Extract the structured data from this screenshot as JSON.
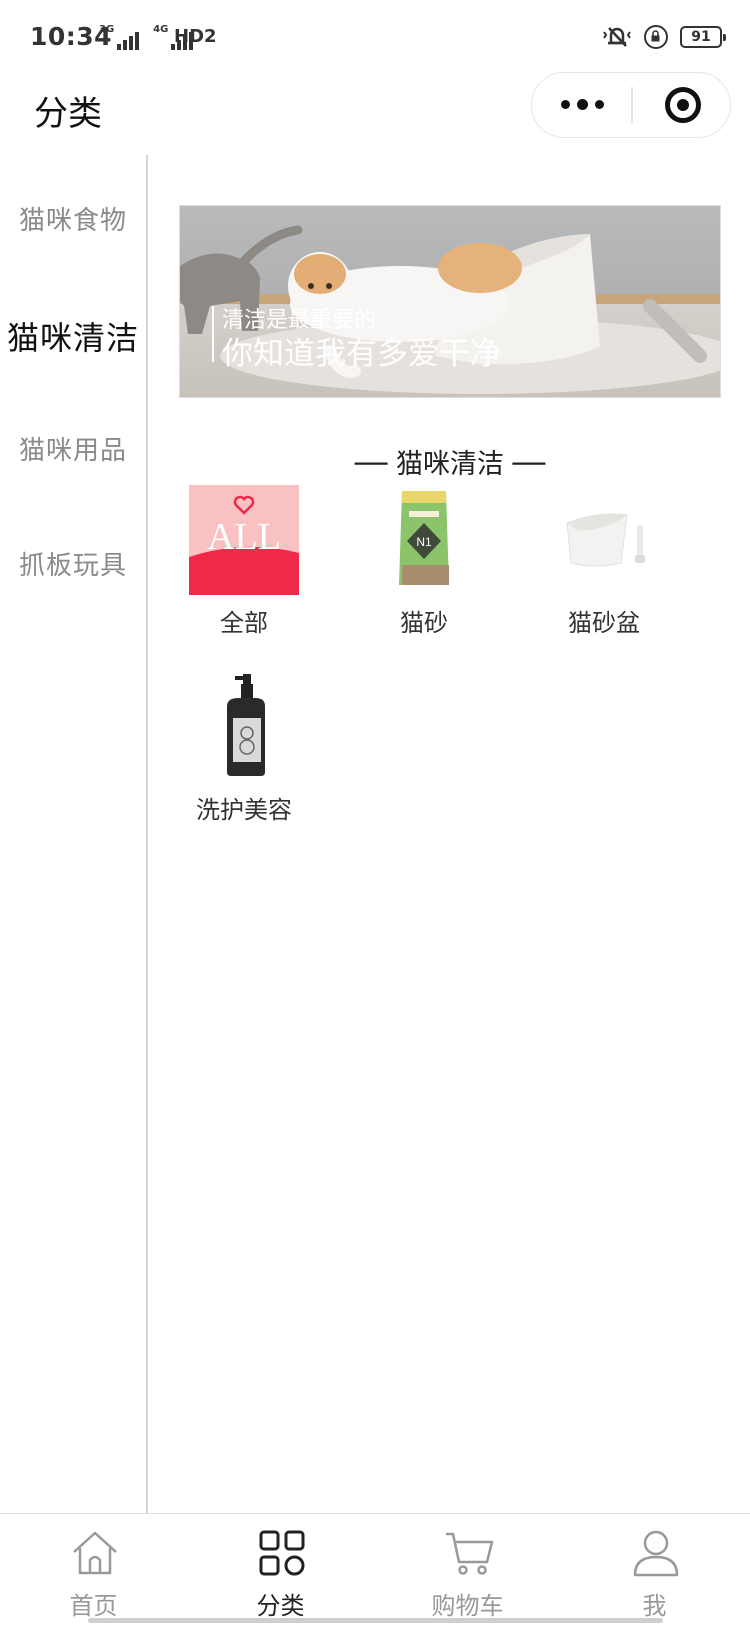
{
  "status_bar": {
    "time": "10:34",
    "net1": "3G",
    "net2": "4G",
    "hd": "HD2",
    "battery": "91"
  },
  "nav": {
    "title": "分类"
  },
  "sidebar": {
    "items": [
      {
        "label": "猫咪食物"
      },
      {
        "label": "猫咪清洁"
      },
      {
        "label": "猫咪用品"
      },
      {
        "label": "抓板玩具"
      }
    ],
    "active_index": 1
  },
  "banner": {
    "line1": "清洁是最重要的",
    "line2": "你知道我有多爱干净"
  },
  "section": {
    "title": "── 猫咪清洁 ──"
  },
  "categories": [
    {
      "label": "全部",
      "badge": "ALL",
      "icon": "all-badge-icon"
    },
    {
      "label": "猫砂",
      "icon": "cat-litter-bag-icon"
    },
    {
      "label": "猫砂盆",
      "icon": "litter-box-icon"
    },
    {
      "label": "洗护美容",
      "icon": "shampoo-bottle-icon"
    }
  ],
  "tabbar": {
    "items": [
      {
        "label": "首页",
        "icon": "home-icon"
      },
      {
        "label": "分类",
        "icon": "category-grid-icon"
      },
      {
        "label": "购物车",
        "icon": "cart-icon"
      },
      {
        "label": "我",
        "icon": "user-icon"
      }
    ],
    "active_index": 1
  },
  "colors": {
    "accent_red": "#f0294a",
    "all_badge_bg": "#f9c1c1"
  }
}
